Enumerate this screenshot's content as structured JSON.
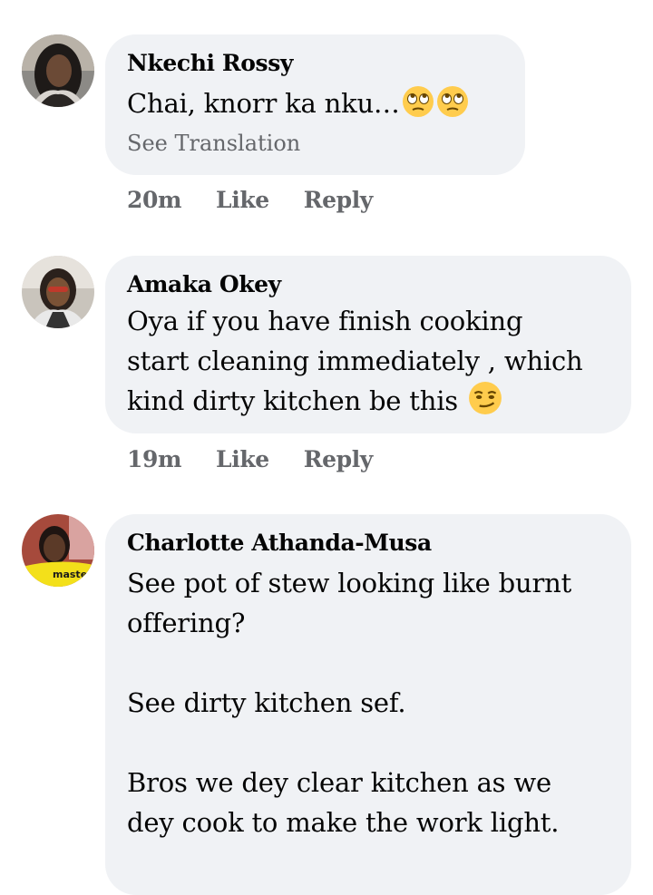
{
  "comments": [
    {
      "author": "Nkechi Rossy",
      "text": "Chai, knorr ka nku…",
      "text_emoji": [
        "eye-roll-emoji",
        "eye-roll-emoji"
      ],
      "see_translation": "See Translation",
      "time": "20m",
      "like_label": "Like",
      "reply_label": "Reply"
    },
    {
      "author": "Amaka Okey",
      "text": "Oya if you have finish cooking\nstart cleaning immediately , which\nkind dirty kitchen be this",
      "text_emoji": [
        "smirk-emoji"
      ],
      "time": "19m",
      "like_label": "Like",
      "reply_label": "Reply"
    },
    {
      "author": "Charlotte Athanda-Musa",
      "text": "See pot of stew looking like burnt\noffering?\n\nSee dirty kitchen sef.\n\nBros we dey clear kitchen as we\ndey cook to make the work light.",
      "avatar_badge": "master"
    }
  ],
  "colors": {
    "bubble": "#f0f2f5",
    "meta_text": "#65676b",
    "text": "#050505"
  }
}
